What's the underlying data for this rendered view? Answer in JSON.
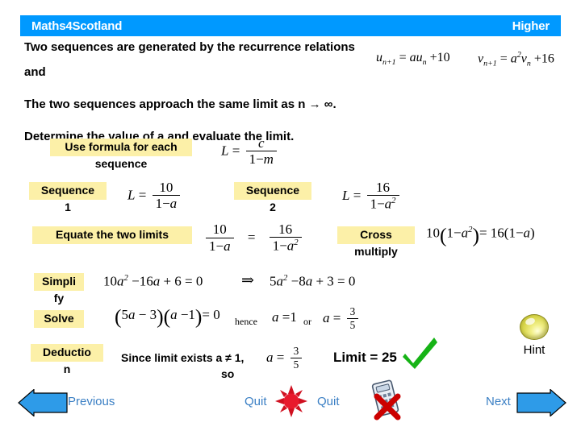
{
  "header": {
    "brand": "Maths4Scotland",
    "level": "Higher",
    "bar_color": "#0099FF"
  },
  "question": {
    "line1": "Two sequences are generated by the recurrence relations",
    "line2": "and",
    "recurrence_1": "u(n+1) = a·u(n) + 10",
    "recurrence_2": "v(n+1) = a²·v(n) + 16",
    "line3": "The two sequences approach the same limit as  n → ∞.",
    "line4": "Determine the value of  a  and evaluate the limit."
  },
  "steps": {
    "use_formula": {
      "label_top": "Use formula for each",
      "label_bottom": "sequence",
      "formula": "L = c / (1 - m)"
    },
    "sequence1": {
      "label_top": "Sequence",
      "label_bottom": "1",
      "formula": "L = 10 / (1 - a)"
    },
    "sequence2": {
      "label_top": "Sequence",
      "label_bottom": "2",
      "formula": "L = 16 / (1 - a²)"
    },
    "equate": {
      "label": "Equate the two limits",
      "formula": "10/(1-a) = 16/(1-a²)"
    },
    "cross_multiply": {
      "label_top": "Cross",
      "label_bottom": "multiply",
      "formula": "10(1 - a²) = 16(1 - a)"
    },
    "simplify": {
      "label_top": "Simpli",
      "label_bottom": "fy",
      "formula_left": "10a² − 16a + 6 = 0",
      "implies": "⇒",
      "formula_right": "5a² − 8a + 3 = 0"
    },
    "solve": {
      "label": "Solve",
      "formula": "(5a − 3)(a − 1) = 0",
      "hence": "hence",
      "root1": "a = 1",
      "or": "or",
      "root2": "a = 3/5"
    },
    "deduction": {
      "label_top": "Deductio",
      "label_bottom": "n",
      "text_line1": "Since limit exists a ≠ 1,",
      "text_line2": "so",
      "value": "a = 3/5"
    }
  },
  "answer": {
    "text": "Limit = 25",
    "check_color": "#16B316"
  },
  "hint": {
    "label": "Hint",
    "icon": "lightbulb-icon"
  },
  "nav": {
    "previous": "Previous",
    "quit_left": "Quit",
    "quit_right": "Quit",
    "next": "Next",
    "arrow_color": "#2E9BE8",
    "link_color": "#3A7FC4",
    "no_calculator_icon": "calculator-crossed-icon"
  }
}
